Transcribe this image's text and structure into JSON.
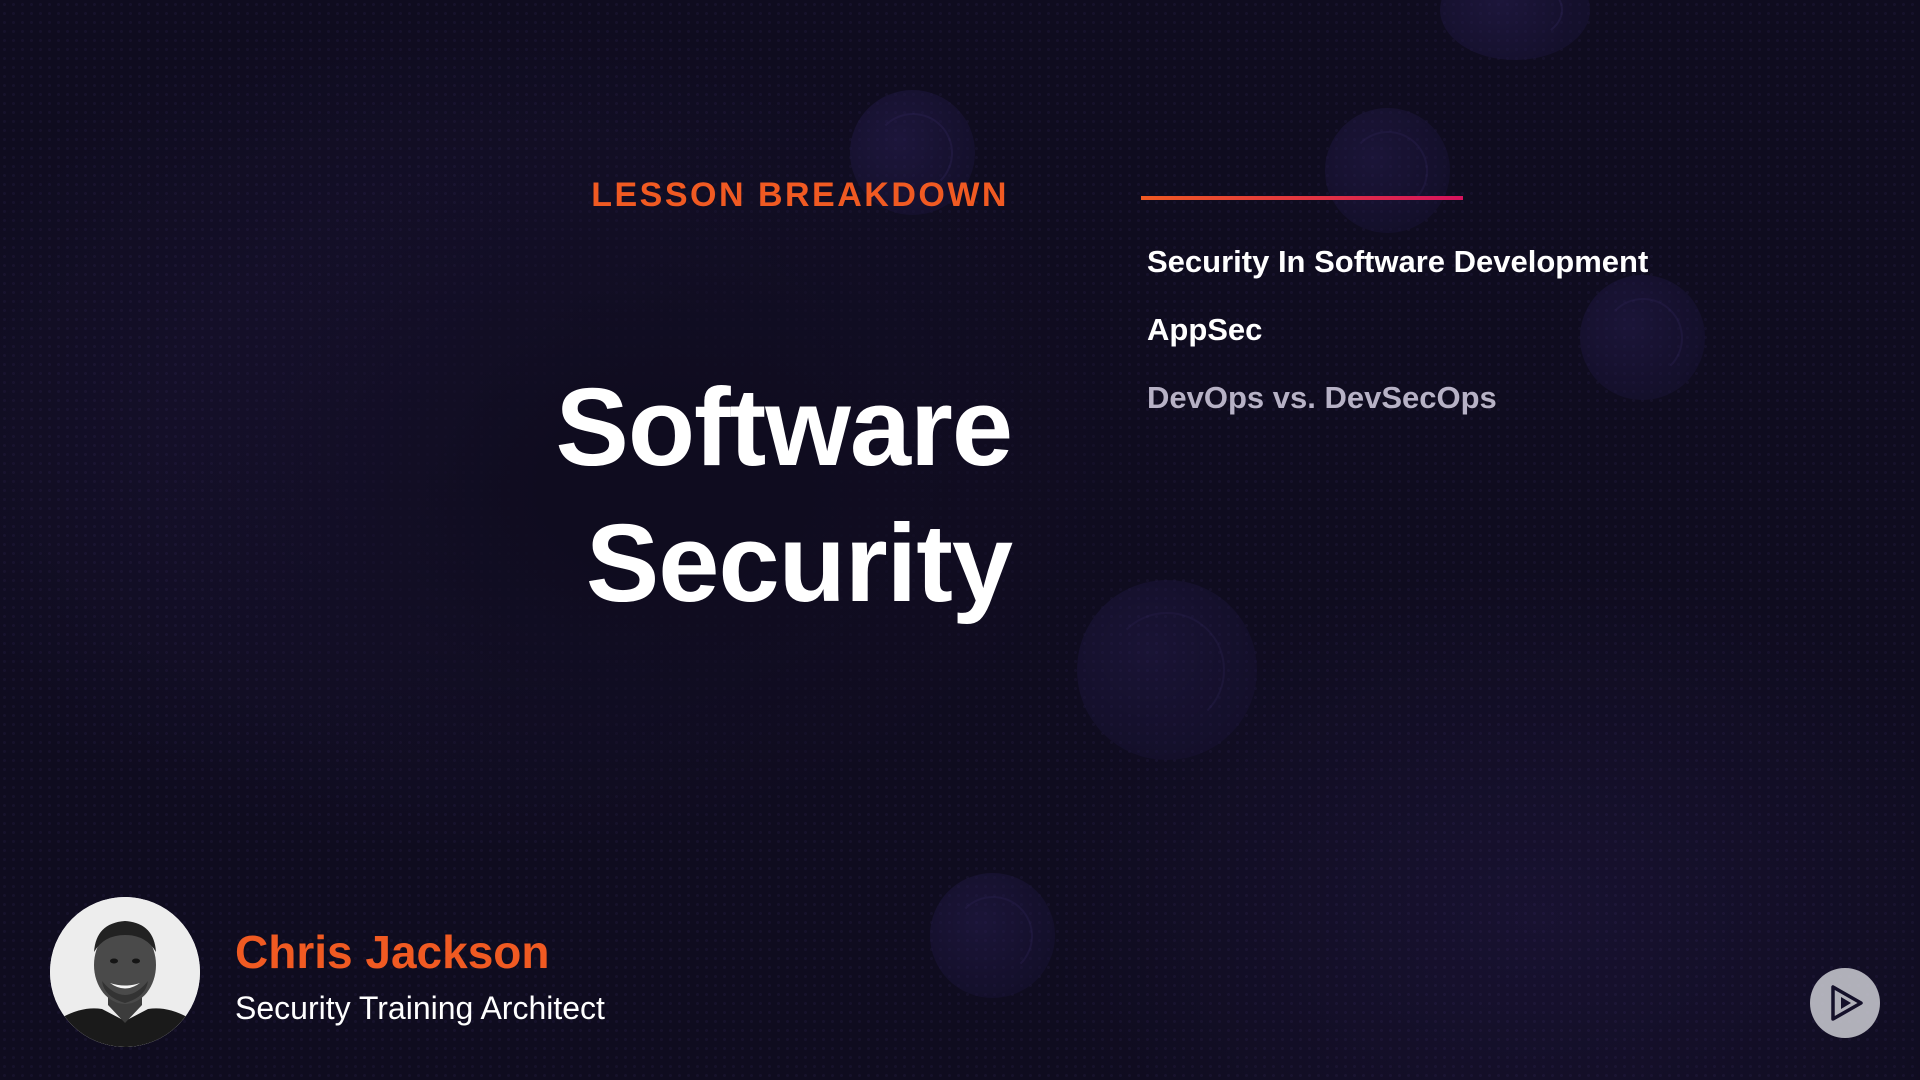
{
  "slide": {
    "section_label": "LESSON BREAKDOWN",
    "title_line1": "Software",
    "title_line2": "Security"
  },
  "topics": [
    {
      "label": "Security In Software Development",
      "state": "active"
    },
    {
      "label": "AppSec",
      "state": "active"
    },
    {
      "label": "DevOps vs. DevSecOps",
      "state": "upcoming"
    }
  ],
  "presenter": {
    "name": "Chris Jackson",
    "role": "Security Training Architect"
  },
  "colors": {
    "background": "#0f0c1f",
    "accent_orange": "#f05a22",
    "accent_pink": "#d6135e",
    "text_primary": "#ffffff",
    "text_dim": "#b7b2c6"
  },
  "icons": {
    "player_logo": "play-triangle-icon"
  }
}
